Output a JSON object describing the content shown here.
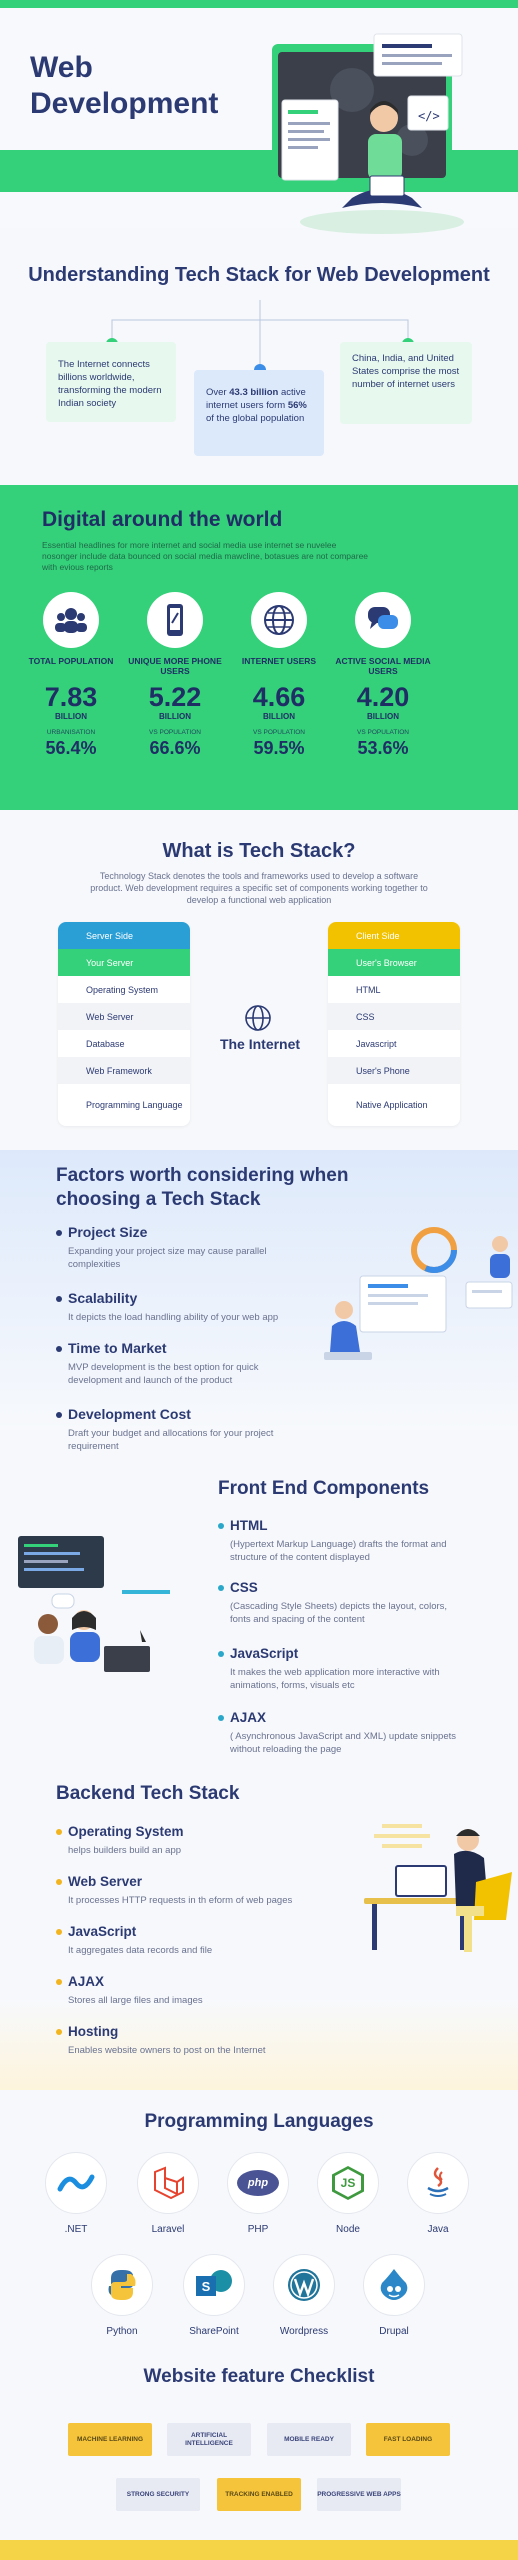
{
  "hero": {
    "title": "Web Development"
  },
  "stack_intro": {
    "title": "Understanding Tech Stack for Web Development",
    "card_left": "The Internet connects billions worldwide, transforming the modern Indian society",
    "card_center_a": "Over ",
    "card_center_b": "43.3 billion",
    "card_center_c": " active internet users form ",
    "card_center_d": "56%",
    "card_center_e": " of the global population",
    "card_right": "China, India, and United States comprise the most number of internet users"
  },
  "digital": {
    "title": "Digital around the world",
    "desc": "Essential headlines for more internet and social media use internet se nuvelee nosonger include data bounced on social media mawcline, botasues are not comparee with evious reports",
    "stats": [
      {
        "label": "TOTAL POPULATION",
        "num": "7.83",
        "unit": "BILLION",
        "sub": "URBANISATION",
        "pct": "56.4%"
      },
      {
        "label": "UNIQUE MORE PHONE USERS",
        "num": "5.22",
        "unit": "BILLION",
        "sub": "VS POPULATION",
        "pct": "66.6%"
      },
      {
        "label": "INTERNET USERS",
        "num": "4.66",
        "unit": "BILLION",
        "sub": "VS POPULATION",
        "pct": "59.5%"
      },
      {
        "label": "ACTIVE SOCIAL MEDIA USERS",
        "num": "4.20",
        "unit": "BILLION",
        "sub": "VS POPULATION",
        "pct": "53.6%"
      }
    ]
  },
  "techstack": {
    "title": "What is Tech Stack?",
    "desc": "Technology Stack denotes the tools and frameworks used to develop a software product. Web development requires a specific set of components working together to develop a functional web application",
    "server": [
      "Server Side",
      "Your Server",
      "Operating System",
      "Web Server",
      "Database",
      "Web Framework",
      "Programming Language"
    ],
    "client": [
      "Client Side",
      "User's Browser",
      "HTML",
      "CSS",
      "Javascript",
      "User's Phone",
      "Native Application"
    ],
    "center": "The Internet"
  },
  "factors": {
    "title": "Factors worth considering when choosing a Tech Stack",
    "items": [
      {
        "h": "Project Size",
        "d": "Expanding your project size may cause parallel complexities"
      },
      {
        "h": "Scalability",
        "d": "It depicts the load handling ability of your web app"
      },
      {
        "h": "Time to Market",
        "d": "MVP development is the best option for quick development and launch of the product"
      },
      {
        "h": "Development Cost",
        "d": "Draft your budget and allocations for your project requirement"
      }
    ]
  },
  "frontend": {
    "title": "Front End Components",
    "items": [
      {
        "h": "HTML",
        "d": "(Hypertext Markup Language) drafts the format and structure of the content displayed"
      },
      {
        "h": "CSS",
        "d": "(Cascading Style Sheets) depicts the layout, colors, fonts and spacing of the content"
      },
      {
        "h": "JavaScript",
        "d": "It makes the web application more interactive with animations, forms, visuals etc"
      },
      {
        "h": "AJAX",
        "d": "( Asynchronous JavaScript and XML) update snippets without reloading the page"
      }
    ]
  },
  "backend": {
    "title": "Backend Tech Stack",
    "items": [
      {
        "h": "Operating System",
        "d": "helps builders build an app"
      },
      {
        "h": "Web Server",
        "d": "It processes HTTP requests in th eform of web pages"
      },
      {
        "h": "JavaScript",
        "d": "It aggregates data records and file"
      },
      {
        "h": "AJAX",
        "d": "Stores all large files and images"
      },
      {
        "h": "Hosting",
        "d": "Enables website owners to post on the Internet"
      }
    ]
  },
  "languages": {
    "title": "Programming Languages",
    "row1": [
      ".NET",
      "Laravel",
      "PHP",
      "Node",
      "Java"
    ],
    "row2": [
      "Python",
      "SharePoint",
      "Wordpress",
      "Drupal"
    ],
    "php_text": "php",
    "js_text": "JS",
    "s_text": "S"
  },
  "checklist": {
    "title": "Website feature Checklist",
    "row1": [
      "MACHINE LEARNING",
      "ARTIFICIAL INTELLIGENCE",
      "MOBILE READY",
      "FAST LOADING"
    ],
    "row2": [
      "STRONG SECURITY",
      "TRACKING ENABLED",
      "PROGRESSIVE WEB APPS"
    ]
  }
}
